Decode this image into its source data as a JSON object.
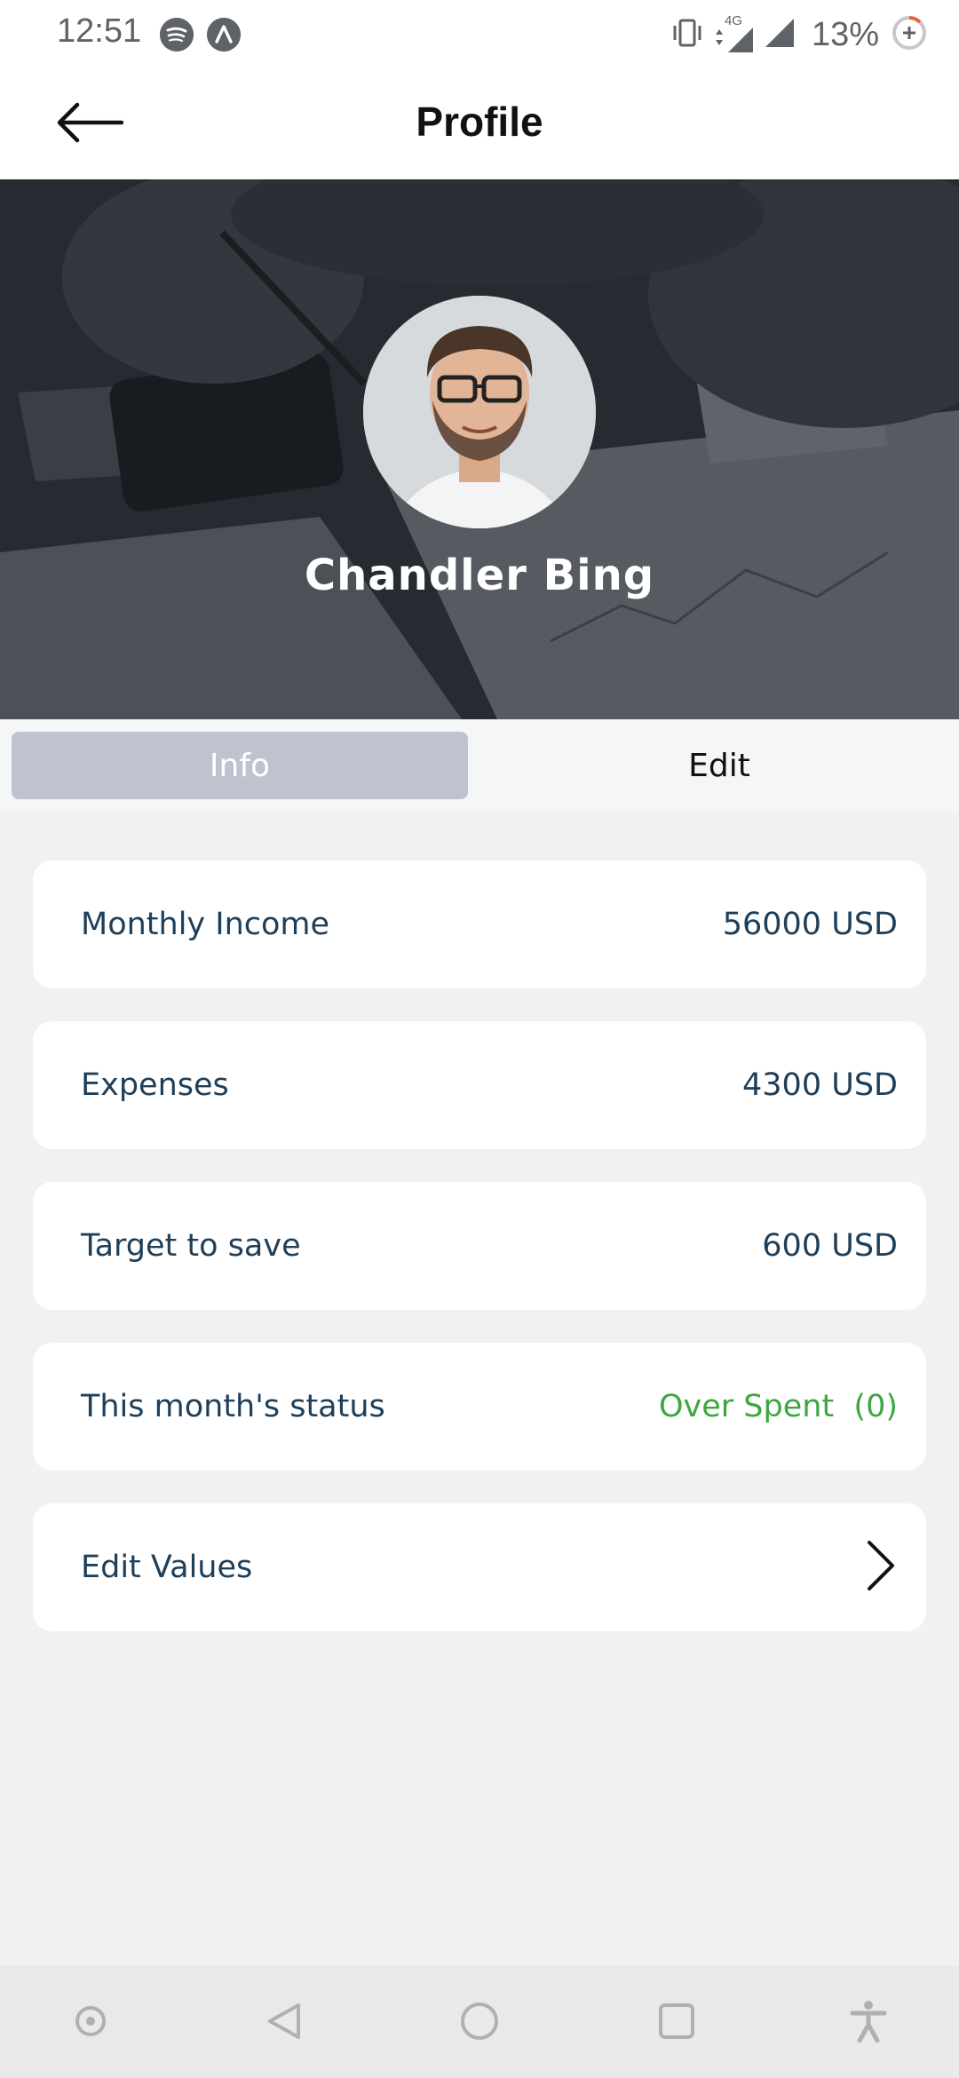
{
  "status_bar": {
    "time": "12:51",
    "network": "4G",
    "battery": "13%"
  },
  "app_bar": {
    "title": "Profile",
    "back_icon": "arrow-left-icon"
  },
  "profile": {
    "name": "Chandler Bing"
  },
  "tabs": [
    {
      "label": "Info",
      "selected": true
    },
    {
      "label": "Edit",
      "selected": false
    }
  ],
  "cards": {
    "income": {
      "label": "Monthly Income",
      "value": "56000 USD"
    },
    "expenses": {
      "label": "Expenses",
      "value": "4300 USD"
    },
    "target": {
      "label": "Target to save",
      "value": "600 USD"
    },
    "status": {
      "label": "This month's status",
      "value": "Over Spent  (0)"
    },
    "edit_values": {
      "label": "Edit Values",
      "icon": "chevron-right-icon"
    }
  },
  "colors": {
    "label_text": "#1e3f5a",
    "status_green": "#3ba73e",
    "tab_selected_bg": "#bfc3cf",
    "background": "#f1f1f2"
  }
}
